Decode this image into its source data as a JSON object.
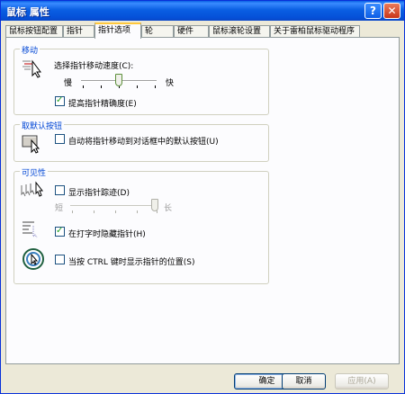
{
  "window": {
    "title": "鼠标 属性"
  },
  "tabs": [
    {
      "label": "鼠标按钮配置"
    },
    {
      "label": "指针"
    },
    {
      "label": "指针选项"
    },
    {
      "label": "轮"
    },
    {
      "label": "硬件"
    },
    {
      "label": "鼠标滚轮设置"
    },
    {
      "label": "关于雷柏鼠标驱动程序"
    }
  ],
  "active_tab": "指针选项",
  "motion": {
    "title": "移动",
    "speed_label": "选择指针移动速度(C):",
    "slow": "慢",
    "fast": "快",
    "speed_level": 0.5,
    "precision_label": "提高指针精确度(E)",
    "precision_checked": true
  },
  "snap": {
    "title": "取默认按钮",
    "label": "自动将指针移动到对话框中的默认按钮(U)",
    "checked": false
  },
  "visibility": {
    "title": "可见性",
    "trails_label": "显示指针踪迹(D)",
    "trails_checked": false,
    "short": "短",
    "long": "长",
    "trails_level": 1.0,
    "hide_label": "在打字时隐藏指针(H)",
    "hide_checked": true,
    "ctrl_label": "当按 CTRL 键时显示指针的位置(S)",
    "ctrl_checked": false
  },
  "buttons": {
    "ok": "确定",
    "cancel": "取消",
    "apply": "应用(A)"
  },
  "colors": {
    "title_bar": "#0a5fe3",
    "group_title": "#0046d5",
    "dialog_bg": "#ece9d8"
  },
  "icons": [
    "help-icon",
    "close-icon",
    "pointer-speed-icon",
    "snap-to-icon",
    "pointer-trails-icon",
    "hide-pointer-icon",
    "show-location-icon"
  ]
}
